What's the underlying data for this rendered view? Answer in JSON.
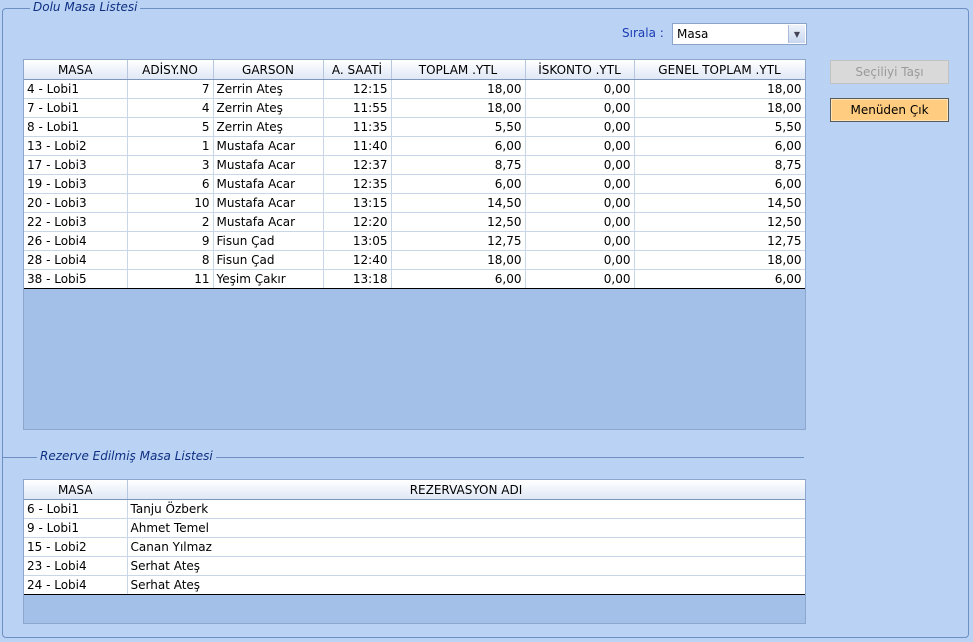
{
  "occupied": {
    "title": "Dolu Masa Listesi",
    "sort_label": "Sırala :",
    "sort_value": "Masa",
    "columns": [
      "MASA",
      "ADİSY.NO",
      "GARSON",
      "A. SAATİ",
      "TOPLAM .YTL",
      "İSKONTO .YTL",
      "GENEL TOPLAM .YTL"
    ],
    "rows": [
      [
        "4 - Lobi1",
        "7",
        "Zerrin Ateş",
        "12:15",
        "18,00",
        "0,00",
        "18,00"
      ],
      [
        "7 - Lobi1",
        "4",
        "Zerrin Ateş",
        "11:55",
        "18,00",
        "0,00",
        "18,00"
      ],
      [
        "8 - Lobi1",
        "5",
        "Zerrin Ateş",
        "11:35",
        "5,50",
        "0,00",
        "5,50"
      ],
      [
        "13 - Lobi2",
        "1",
        "Mustafa Acar",
        "11:40",
        "6,00",
        "0,00",
        "6,00"
      ],
      [
        "17 - Lobi3",
        "3",
        "Mustafa Acar",
        "12:37",
        "8,75",
        "0,00",
        "8,75"
      ],
      [
        "19 - Lobi3",
        "6",
        "Mustafa Acar",
        "12:35",
        "6,00",
        "0,00",
        "6,00"
      ],
      [
        "20 - Lobi3",
        "10",
        "Mustafa Acar",
        "13:15",
        "14,50",
        "0,00",
        "14,50"
      ],
      [
        "22 - Lobi3",
        "2",
        "Mustafa Acar",
        "12:20",
        "12,50",
        "0,00",
        "12,50"
      ],
      [
        "26 - Lobi4",
        "9",
        "Fisun Çad",
        "13:05",
        "12,75",
        "0,00",
        "12,75"
      ],
      [
        "28 - Lobi4",
        "8",
        "Fisun Çad",
        "12:40",
        "18,00",
        "0,00",
        "18,00"
      ],
      [
        "38 - Lobi5",
        "11",
        "Yeşim Çakır",
        "13:18",
        "6,00",
        "0,00",
        "6,00"
      ]
    ]
  },
  "reserved": {
    "title": "Rezerve Edilmiş Masa Listesi",
    "columns": [
      "MASA",
      "REZERVASYON ADI"
    ],
    "rows": [
      [
        "6 - Lobi1",
        "Tanju Özberk"
      ],
      [
        "9 - Lobi1",
        "Ahmet Temel"
      ],
      [
        "15 - Lobi2",
        "Canan Yılmaz"
      ],
      [
        "23 - Lobi4",
        "Serhat Ateş"
      ],
      [
        "24 - Lobi4",
        "Serhat Ateş"
      ]
    ]
  },
  "buttons": {
    "move_selected": "Seçiliyi Taşı",
    "exit_menu": "Menüden Çık"
  },
  "icons": {
    "dropdown": "chevron-down-icon"
  }
}
